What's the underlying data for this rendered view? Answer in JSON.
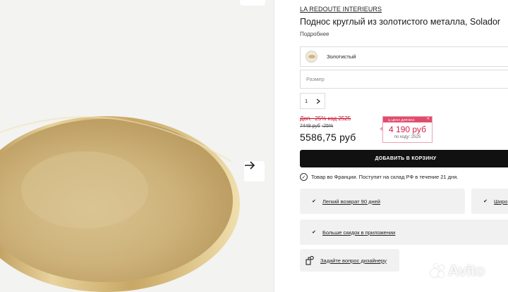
{
  "brand": "LA REDOUTE INTERIEURS",
  "product_title": "Поднос круглый из золотистого металла, Solador",
  "details_link": "Подробнее",
  "color_select": {
    "value": "Золотистый"
  },
  "size_select": {
    "placeholder": "Размер"
  },
  "quantity": "1",
  "promo_line": "Доп. -25% код 2525",
  "old_price": "7449 руб",
  "old_discount": "-25%",
  "price": "5586,75 руб",
  "price_card": {
    "header": "Ц цена для вас",
    "price": "4 190 руб",
    "code": "по коду: 2525",
    "accent": "#e14c6c"
  },
  "add_to_cart": "ДОБАВИТЬ В КОРЗИНУ",
  "shipping_note": "Товар во Франции. Поступит на склад РФ в течение 21 дня.",
  "benefits": [
    {
      "label": "Легкий возврат 90 дней",
      "icon": "check-icon"
    },
    {
      "label": "Широ",
      "icon": "check-icon"
    },
    {
      "label": "Больше скидок в приложении",
      "icon": "check-icon"
    },
    {
      "label": "Задайте вопрос дизайнеру",
      "icon": "designer-icon"
    }
  ],
  "watermark": "Avito",
  "colors": {
    "gold": "#d3b57a",
    "button": "#111111",
    "sale_red": "#c8102e",
    "card_pink": "#e14c6c"
  }
}
